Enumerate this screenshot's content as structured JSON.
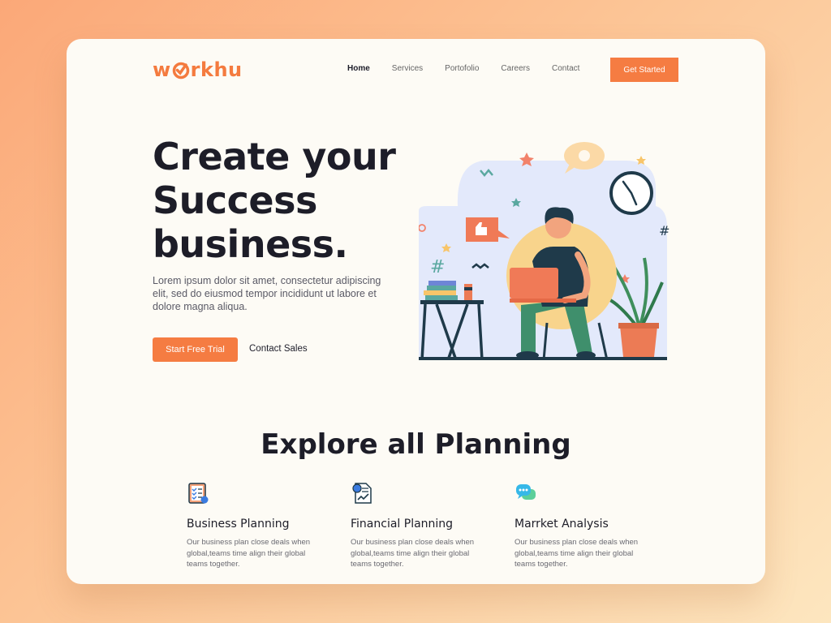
{
  "brand": {
    "logo": "workhu",
    "accent": "#f57c42"
  },
  "nav": {
    "items": [
      {
        "label": "Home",
        "active": true
      },
      {
        "label": "Services",
        "active": false
      },
      {
        "label": "Portofolio",
        "active": false
      },
      {
        "label": "Careers",
        "active": false
      },
      {
        "label": "Contact",
        "active": false
      }
    ],
    "cta": "Get Started"
  },
  "hero": {
    "title_lines": [
      "Create your",
      "Success",
      "business."
    ],
    "description": "Lorem ipsum dolor sit amet, consectetur adipiscing elit, sed do eiusmod tempor incididunt ut labore et dolore magna aliqua.",
    "primary_button": "Start Free Trial",
    "secondary_button": "Contact Sales",
    "illustration": "person-working-on-laptop-illustration"
  },
  "explore": {
    "title": "Explore all Planning",
    "features": [
      {
        "icon": "checklist-icon",
        "title": "Business Planning",
        "text": "Our business plan close deals when global,teams time align their global teams together."
      },
      {
        "icon": "financial-document-icon",
        "title": "Financial Planning",
        "text": "Our business plan close deals when global,teams time align their global teams together."
      },
      {
        "icon": "chat-bubbles-icon",
        "title": "Marrket Analysis",
        "text": "Our business plan close deals when global,teams time align their global teams together."
      }
    ]
  }
}
